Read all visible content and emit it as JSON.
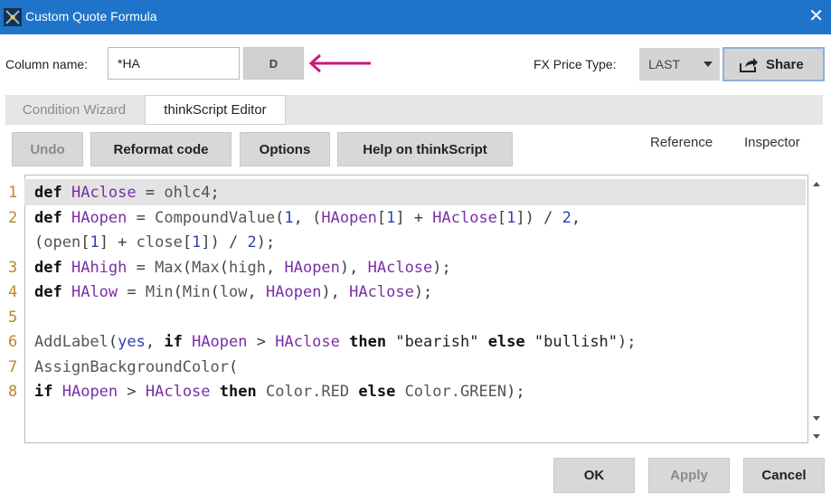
{
  "window": {
    "title": "Custom Quote Formula",
    "close_glyph": "✕"
  },
  "form": {
    "column_name_label": "Column name:",
    "column_name_value": "*HA",
    "d_button_label": "D",
    "fx_price_label": "FX Price Type:",
    "fx_price_value": "LAST",
    "share_label": "Share"
  },
  "tabs": [
    {
      "label": "Condition Wizard",
      "active": false
    },
    {
      "label": "thinkScript Editor",
      "active": true
    }
  ],
  "toolbar": {
    "undo_label": "Undo",
    "reformat_label": "Reformat code",
    "options_label": "Options",
    "help_label": "Help on thinkScript",
    "reference_label": "Reference",
    "inspector_label": "Inspector"
  },
  "editor": {
    "line_numbers": [
      "1",
      "2",
      "3",
      "4",
      "5",
      "6",
      "7",
      "8"
    ],
    "lines": [
      "def HAclose = ohlc4;",
      "def HAopen = CompoundValue(1, (HAopen[1] + HAclose[1]) / 2,",
      "(open[1] + close[1]) / 2);",
      "def HAhigh = Max(Max(high, HAopen), HAclose);",
      "def HAlow = Min(Min(low, HAopen), HAclose);",
      "",
      "AddLabel(yes, if HAopen > HAclose then \"bearish\" else \"bullish\");",
      "AssignBackgroundColor(",
      "if HAopen > HAclose then Color.RED else Color.GREEN);"
    ]
  },
  "footer": {
    "ok_label": "OK",
    "apply_label": "Apply",
    "cancel_label": "Cancel"
  },
  "colors": {
    "titlebar": "#1e74c9",
    "annotation_arrow": "#d0157a",
    "keyword": "#111111",
    "variable": "#7a2ea6",
    "number": "#2f3fb0",
    "line_number": "#b8872f"
  },
  "icons": {
    "app": "thinkorswim-app-icon",
    "share": "share-arrow-icon",
    "annotation": "left-arrow-annotation-icon"
  }
}
